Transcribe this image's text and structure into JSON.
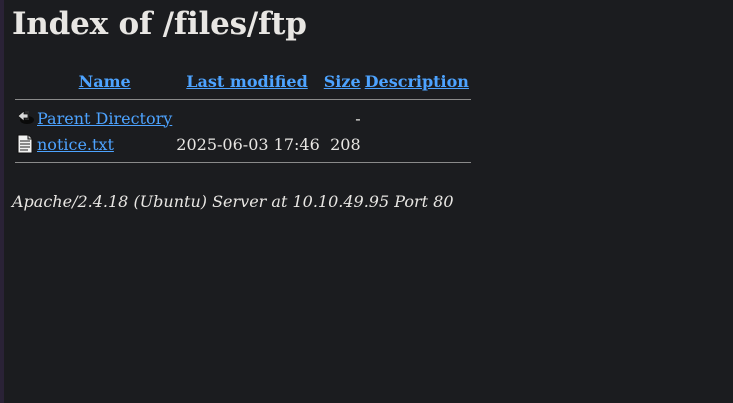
{
  "page": {
    "title": "Index of /files/ftp"
  },
  "table": {
    "headers": {
      "name": "Name",
      "last_modified": "Last modified",
      "size": "Size",
      "description": "Description"
    },
    "rows": [
      {
        "icon": "back-icon",
        "name": "Parent Directory",
        "last_modified": "",
        "size": "-",
        "description": ""
      },
      {
        "icon": "text-file-icon",
        "name": "notice.txt",
        "last_modified": "2025-06-03 17:46",
        "size": "208",
        "description": ""
      }
    ]
  },
  "footer": {
    "address": "Apache/2.4.18 (Ubuntu) Server at 10.10.49.95 Port 80"
  },
  "colors": {
    "background": "#1b1c1f",
    "text": "#e8e6e3",
    "link": "#4da3ff",
    "rule": "#8a8a8a"
  }
}
